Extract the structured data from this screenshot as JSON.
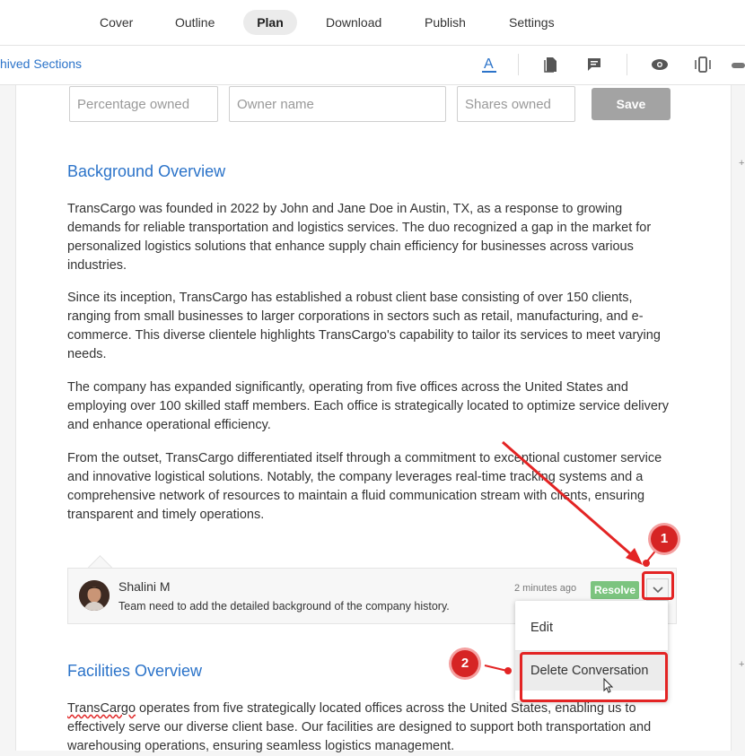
{
  "nav": {
    "tabs": [
      "Cover",
      "Outline",
      "Plan",
      "Download",
      "Publish",
      "Settings"
    ],
    "active_tab": "Plan"
  },
  "toolbar": {
    "archived_label": "hived Sections",
    "icons": [
      "font-color-icon",
      "document-icon",
      "comment-icon",
      "eye-icon",
      "device-icon"
    ]
  },
  "ownership_form": {
    "percentage_placeholder": "Percentage owned",
    "owner_placeholder": "Owner name",
    "shares_placeholder": "Shares owned",
    "save_label": "Save"
  },
  "background": {
    "heading": "Background Overview",
    "paragraphs": [
      "TransCargo was founded in 2022 by John and Jane Doe in Austin, TX, as a response to growing demands for reliable transportation and logistics services. The duo recognized a gap in the market for personalized logistics solutions that enhance supply chain efficiency for businesses across various industries.",
      "Since its inception, TransCargo has established a robust client base consisting of over 150 clients, ranging from small businesses to larger corporations in sectors such as retail, manufacturing, and e-commerce. This diverse clientele highlights TransCargo's capability to tailor its services to meet varying needs.",
      "The company has expanded significantly, operating from five offices across the United States and employing over 100 skilled staff members. Each office is strategically located to optimize service delivery and enhance operational efficiency.",
      "From the outset, TransCargo differentiated itself through a commitment to exceptional customer service and innovative logistical solutions. Notably, the company leverages real-time tracking systems and a comprehensive network of resources to maintain a fluid communication stream with clients, ensuring transparent and timely operations."
    ]
  },
  "comment": {
    "author": "Shalini M",
    "text": "Team need to add the detailed background of the company history.",
    "time": "2 minutes ago",
    "resolve_label": "Resolve"
  },
  "comment_menu": {
    "edit_label": "Edit",
    "delete_label": "Delete Conversation"
  },
  "facilities": {
    "heading": "Facilities Overview",
    "lead_word": "TransCargo",
    "paragraph_rest": " operates from five strategically located offices across the United States, enabling us to effectively serve our diverse client base. Our facilities are designed to support both transportation and warehousing operations, ensuring seamless logistics management."
  },
  "annotations": {
    "step1": "1",
    "step2": "2",
    "highlight_color": "#e32424"
  }
}
